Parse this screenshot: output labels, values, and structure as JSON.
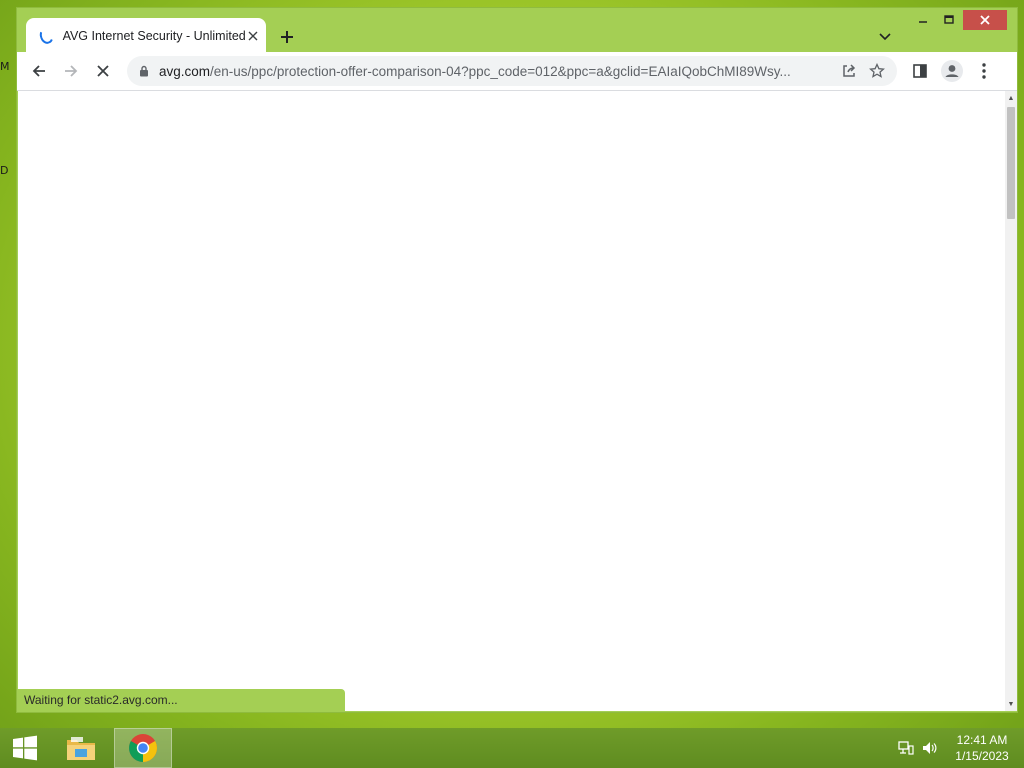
{
  "desktop": {
    "edge_char_1": "M",
    "edge_char_2": "D"
  },
  "browser": {
    "tab": {
      "title": "AVG Internet Security - Unlimited"
    },
    "omnibox": {
      "host": "avg.com",
      "path": "/en-us/ppc/protection-offer-comparison-04?ppc_code=012&ppc=a&gclid=EAIaIQobChMI89Wsy..."
    },
    "status_text": "Waiting for static2.avg.com...",
    "icons": {
      "back": "back-arrow-icon",
      "forward": "forward-arrow-icon",
      "stop": "stop-icon",
      "lock": "lock-icon",
      "share": "share-icon",
      "bookmark": "star-icon",
      "side_panel": "side-panel-icon",
      "profile": "profile-icon",
      "menu": "kebab-menu-icon"
    },
    "colors": {
      "frame": "#a4cf54",
      "close_button": "#c7504a",
      "accent": "#1a73e8"
    }
  },
  "taskbar": {
    "items": [
      "Start",
      "File Explorer",
      "Google Chrome"
    ],
    "time": "12:41 AM",
    "date": "1/15/2023"
  }
}
